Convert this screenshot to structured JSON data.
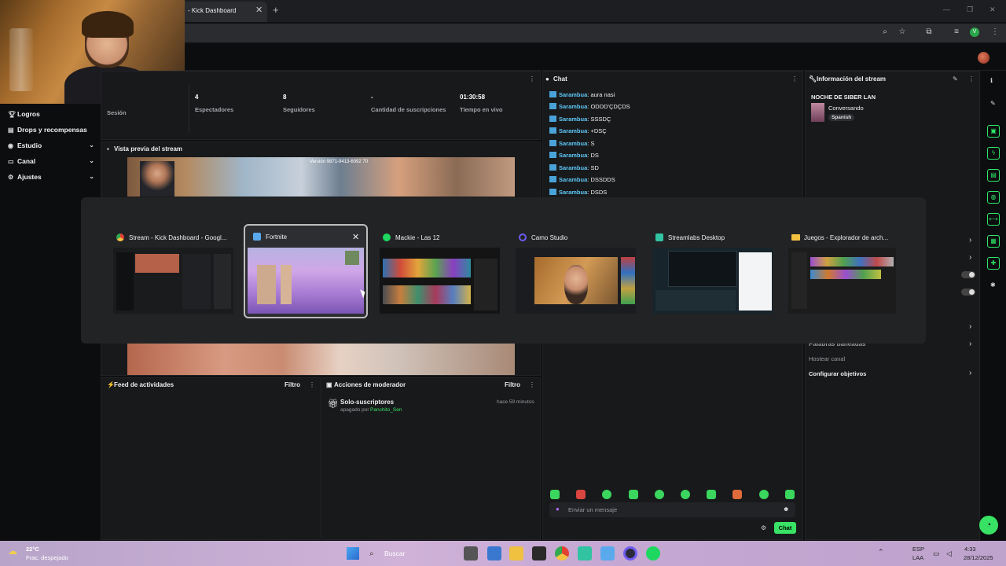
{
  "browser": {
    "tab_title": "- Kick Dashboard",
    "tab_close": "✕",
    "new_tab": "+"
  },
  "stats": [
    {
      "value": "",
      "label": "Sesión"
    },
    {
      "value": "4",
      "label": "Espectadores"
    },
    {
      "value": "8",
      "label": "Seguidores"
    },
    {
      "value": "-",
      "label": "Cantidad de suscripciones"
    },
    {
      "value": "01:30:58",
      "label": "Tiempo en vivo"
    }
  ],
  "sidebar": {
    "items": [
      {
        "icon": "trophy-icon",
        "label": "Logros",
        "has_chevron": false
      },
      {
        "icon": "gift-icon",
        "label": "Drops y recompensas",
        "has_chevron": false
      },
      {
        "icon": "studio-icon",
        "label": "Estudio",
        "has_chevron": true
      },
      {
        "icon": "channel-icon",
        "label": "Canal",
        "has_chevron": true
      },
      {
        "icon": "gear-icon",
        "label": "Ajustes",
        "has_chevron": true
      }
    ]
  },
  "preview": {
    "title": "Vista previa del stream",
    "overlay_text": "Versión 9871-9413-6092 70"
  },
  "feed": {
    "title": "Feed de actividades",
    "filter": "Filtro"
  },
  "mod": {
    "title": "Acciones de moderador",
    "filter": "Filtro",
    "action_title": "Solo-suscriptores",
    "action_desc": "apagado por",
    "action_user": "Panchito_Sen",
    "action_time": "hace 59 minutos"
  },
  "chat": {
    "title": "Chat",
    "messages": [
      {
        "user": "Sarambua",
        "text": "aura nasi"
      },
      {
        "user": "Sarambua",
        "text": "ODDD'ÇDÇDS"
      },
      {
        "user": "Sarambua",
        "text": "SSSDÇ"
      },
      {
        "user": "Sarambua",
        "text": "+DSÇ"
      },
      {
        "user": "Sarambua",
        "text": "S"
      },
      {
        "user": "Sarambua",
        "text": "DS"
      },
      {
        "user": "Sarambua",
        "text": "SD"
      },
      {
        "user": "Sarambua",
        "text": "DSSDDS"
      },
      {
        "user": "Sarambua",
        "text": "DSDS"
      }
    ],
    "input_placeholder": "Enviar un mensaje",
    "send_label": "Chat"
  },
  "info": {
    "title": "Información del stream",
    "stream_title": "NOCHE DE SIBER LAN",
    "category": "Conversando",
    "language": "Spanish",
    "menu_items": [
      "Palabras baneadas",
      "Hostear canal",
      "Configurar objetivos"
    ]
  },
  "switcher": {
    "windows": [
      {
        "title": "Stream - Kick Dashboard - Googl...",
        "icon": "chrome-icon",
        "icon_color": "#e8c340"
      },
      {
        "title": "Fortnite",
        "icon": "fortnite-icon",
        "icon_color": "#5aa9ec"
      },
      {
        "title": "Mackie - Las 12",
        "icon": "spotify-icon",
        "icon_color": "#1ed760"
      },
      {
        "title": "Camo Studio",
        "icon": "camo-icon",
        "icon_color": "#6d5cf0"
      },
      {
        "title": "Streamlabs Desktop",
        "icon": "streamlabs-icon",
        "icon_color": "#31c3a2"
      },
      {
        "title": "Juegos - Explorador de arch...",
        "icon": "folder-icon",
        "icon_color": "#f2c040"
      }
    ],
    "close_glyph": "✕"
  },
  "taskbar": {
    "weather_temp": "22°C",
    "weather_desc": "Frac. despejado",
    "search": "Buscar",
    "lang1": "ESP",
    "lang2": "LAA",
    "time": "4:33",
    "date": "28/12/2025"
  },
  "colors": {
    "accent": "#38e264",
    "chat_user": "#5ec8f8"
  }
}
